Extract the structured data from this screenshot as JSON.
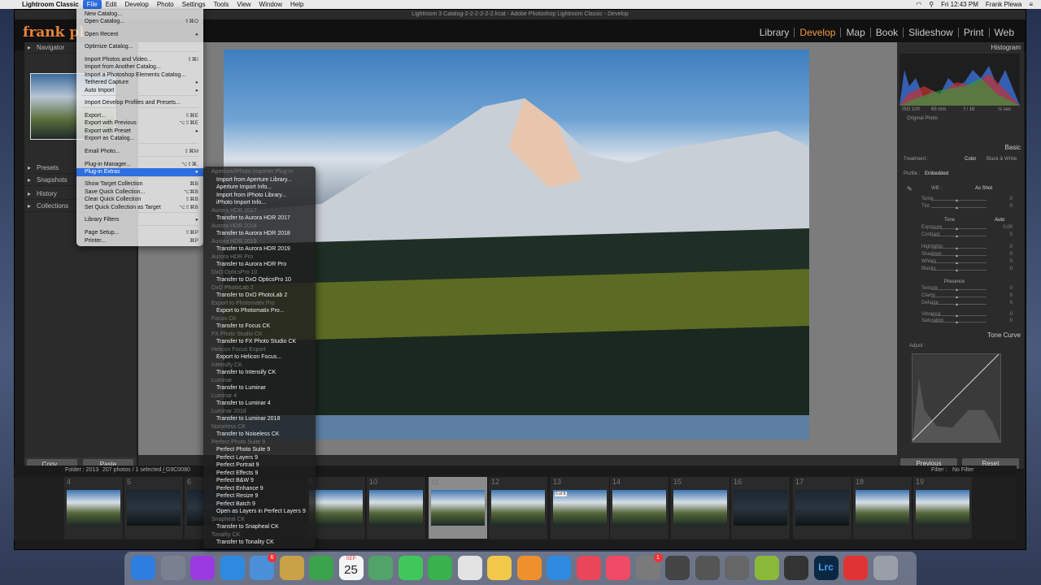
{
  "menubar": {
    "app_name": "Lightroom Classic",
    "items": [
      "File",
      "Edit",
      "Develop",
      "Photo",
      "Settings",
      "Tools",
      "View",
      "Window",
      "Help"
    ],
    "selected": "File",
    "clock": "Fri 12:43 PM",
    "user": "Frank Plewa"
  },
  "window": {
    "title": "Lightroom 3 Catalog-2-2-2-2-2-2.lrcat - Adobe Photoshop Lightroom Classic - Develop",
    "brand": "frank pl",
    "modules": [
      "Library",
      "Develop",
      "Map",
      "Book",
      "Slideshow",
      "Print",
      "Web"
    ],
    "active_module": "Develop"
  },
  "left_panel": {
    "navigator": "Navigator",
    "presets": "Presets",
    "snapshots": "Snapshots",
    "history": "History",
    "collections": "Collections",
    "copy_button": "Copy...",
    "paste_button": "Paste"
  },
  "file_menu": {
    "items": [
      {
        "label": "New Catalog...",
        "key": ""
      },
      {
        "label": "Open Catalog...",
        "key": "⇧⌘O"
      },
      {
        "label": "Open Recent",
        "key": "▸"
      },
      {
        "label": "Optimize Catalog...",
        "key": ""
      },
      {
        "label": "Import Photos and Video...",
        "key": "⇧⌘I"
      },
      {
        "label": "Import from Another Catalog...",
        "key": ""
      },
      {
        "label": "Import a Photoshop Elements Catalog...",
        "key": ""
      },
      {
        "label": "Tethered Capture",
        "key": "▸"
      },
      {
        "label": "Auto Import",
        "key": "▸"
      },
      {
        "label": "Import Develop Profiles and Presets...",
        "key": ""
      },
      {
        "label": "Export...",
        "key": "⇧⌘E"
      },
      {
        "label": "Export with Previous",
        "key": "⌥⇧⌘E"
      },
      {
        "label": "Export with Preset",
        "key": "▸"
      },
      {
        "label": "Export as Catalog...",
        "key": ""
      },
      {
        "label": "Email Photo...",
        "key": "⇧⌘M"
      },
      {
        "label": "Plug-in Manager...",
        "key": "⌥⇧⌘,"
      },
      {
        "label": "Plug-in Extras",
        "key": "▸"
      },
      {
        "label": "Show Target Collection",
        "key": "⌘B"
      },
      {
        "label": "Save Quick Collection...",
        "key": "⌥⌘B"
      },
      {
        "label": "Clear Quick Collection",
        "key": "⇧⌘B"
      },
      {
        "label": "Set Quick Collection as Target",
        "key": "⌥⇧⌘B"
      },
      {
        "label": "Library Filters",
        "key": "▸"
      },
      {
        "label": "Page Setup...",
        "key": "⇧⌘P"
      },
      {
        "label": "Printer...",
        "key": "⌘P"
      }
    ]
  },
  "submenu": {
    "entries": [
      {
        "t": "hd",
        "label": "Aperture/iPhoto Importer Plug-in"
      },
      {
        "t": "it",
        "label": "Import from Aperture Library..."
      },
      {
        "t": "it",
        "label": "Aperture Import Info..."
      },
      {
        "t": "it",
        "label": "Import from iPhoto Library..."
      },
      {
        "t": "it",
        "label": "iPhoto Import Info..."
      },
      {
        "t": "hd",
        "label": "Aurora HDR 2017"
      },
      {
        "t": "it",
        "label": "Transfer to Aurora HDR 2017"
      },
      {
        "t": "hd",
        "label": "Aurora HDR 2018"
      },
      {
        "t": "it",
        "label": "Transfer to Aurora HDR 2018"
      },
      {
        "t": "hd",
        "label": "Aurora HDR 2019"
      },
      {
        "t": "it",
        "label": "Transfer to Aurora HDR 2019"
      },
      {
        "t": "hd",
        "label": "Aurora HDR Pro"
      },
      {
        "t": "it",
        "label": "Transfer to Aurora HDR Pro"
      },
      {
        "t": "hd",
        "label": "DxO OpticsPro 10"
      },
      {
        "t": "it",
        "label": "Transfer to DxO OpticsPro 10"
      },
      {
        "t": "hd",
        "label": "DxO PhotoLab 2"
      },
      {
        "t": "it",
        "label": "Transfer to DxO PhotoLab 2"
      },
      {
        "t": "hd",
        "label": "Export to Photomatix Pro"
      },
      {
        "t": "it",
        "label": "Export to Photomatix Pro..."
      },
      {
        "t": "hd",
        "label": "Focus CK"
      },
      {
        "t": "it",
        "label": "Transfer to Focus CK"
      },
      {
        "t": "hd",
        "label": "FX Photo Studio CK"
      },
      {
        "t": "it",
        "label": "Transfer to FX Photo Studio CK"
      },
      {
        "t": "hd",
        "label": "Helicon Focus Export"
      },
      {
        "t": "it",
        "label": "Export to Helicon Focus..."
      },
      {
        "t": "hd",
        "label": "Intensify CK"
      },
      {
        "t": "it",
        "label": "Transfer to Intensify CK"
      },
      {
        "t": "hd",
        "label": "Luminar"
      },
      {
        "t": "it",
        "label": "Transfer to Luminar"
      },
      {
        "t": "hd",
        "label": "Luminar 4"
      },
      {
        "t": "it",
        "label": "Transfer to Luminar 4"
      },
      {
        "t": "hd",
        "label": "Luminar 2018"
      },
      {
        "t": "it",
        "label": "Transfer to Luminar 2018"
      },
      {
        "t": "hd",
        "label": "Noiseless CK"
      },
      {
        "t": "it",
        "label": "Transfer to Noiseless CK"
      },
      {
        "t": "hd",
        "label": "Perfect Photo Suite 9"
      },
      {
        "t": "it",
        "label": "Perfect Photo Suite 9"
      },
      {
        "t": "it",
        "label": "Perfect Layers 9"
      },
      {
        "t": "it",
        "label": "Perfect Portrait 9"
      },
      {
        "t": "it",
        "label": "Perfect Effects 9"
      },
      {
        "t": "it",
        "label": "Perfect B&W 9"
      },
      {
        "t": "it",
        "label": "Perfect Enhance 9"
      },
      {
        "t": "it",
        "label": "Perfect Resize 9"
      },
      {
        "t": "it",
        "label": "Perfect Batch 9"
      },
      {
        "t": "it",
        "label": "Open as Layers in Perfect Layers 9"
      },
      {
        "t": "hd",
        "label": "Snapheal CK"
      },
      {
        "t": "it",
        "label": "Transfer to Snapheal CK"
      },
      {
        "t": "hd",
        "label": "Tonality CK"
      },
      {
        "t": "it",
        "label": "Transfer to Tonality CK"
      }
    ]
  },
  "right_panel": {
    "histogram": "Histogram",
    "exif": [
      "ISO 100",
      "65 mm",
      "f / 16",
      "⅛ sec"
    ],
    "original_photo": "Original Photo",
    "basic": "Basic",
    "treatment_label": "Treatment :",
    "treatment_color": "Color",
    "treatment_bw": "Black & White",
    "profile_label": "Profile :",
    "profile_value": "Embedded",
    "wb_label": "WB :",
    "wb_value": "As Shot",
    "tone_label": "Tone",
    "auto": "Auto",
    "presence_label": "Presence",
    "sliders": [
      {
        "name": "Temp",
        "value": "0"
      },
      {
        "name": "Tint",
        "value": "0"
      },
      {
        "name": "Exposure",
        "value": "0.00"
      },
      {
        "name": "Contrast",
        "value": "0"
      },
      {
        "name": "Highlights",
        "value": "0"
      },
      {
        "name": "Shadows",
        "value": "0"
      },
      {
        "name": "Whites",
        "value": "0"
      },
      {
        "name": "Blacks",
        "value": "0"
      },
      {
        "name": "Texture",
        "value": "0"
      },
      {
        "name": "Clarity",
        "value": "0"
      },
      {
        "name": "Dehaze",
        "value": "0"
      },
      {
        "name": "Vibrance",
        "value": "0"
      },
      {
        "name": "Saturation",
        "value": "0"
      }
    ],
    "tone_curve": "Tone Curve",
    "adjust": "Adjust :",
    "previous_button": "Previous",
    "reset_button": "Reset"
  },
  "filmstrip": {
    "folder": "Folder : 2013",
    "count": "207 photos / 1 selected /",
    "filename": "_G9C0080",
    "filter_label": "Filter :",
    "filter_value": "No Filter",
    "badge": "6 of 8",
    "numbers": [
      "4",
      "5",
      "6",
      "9",
      "10",
      "11",
      "12",
      "13",
      "14",
      "15",
      "16",
      "17",
      "18",
      "19"
    ]
  },
  "dock": {
    "calendar_month": "SEP",
    "calendar_day": "25",
    "badges": [
      "6",
      "1"
    ],
    "lrc_label": "Lrc"
  }
}
